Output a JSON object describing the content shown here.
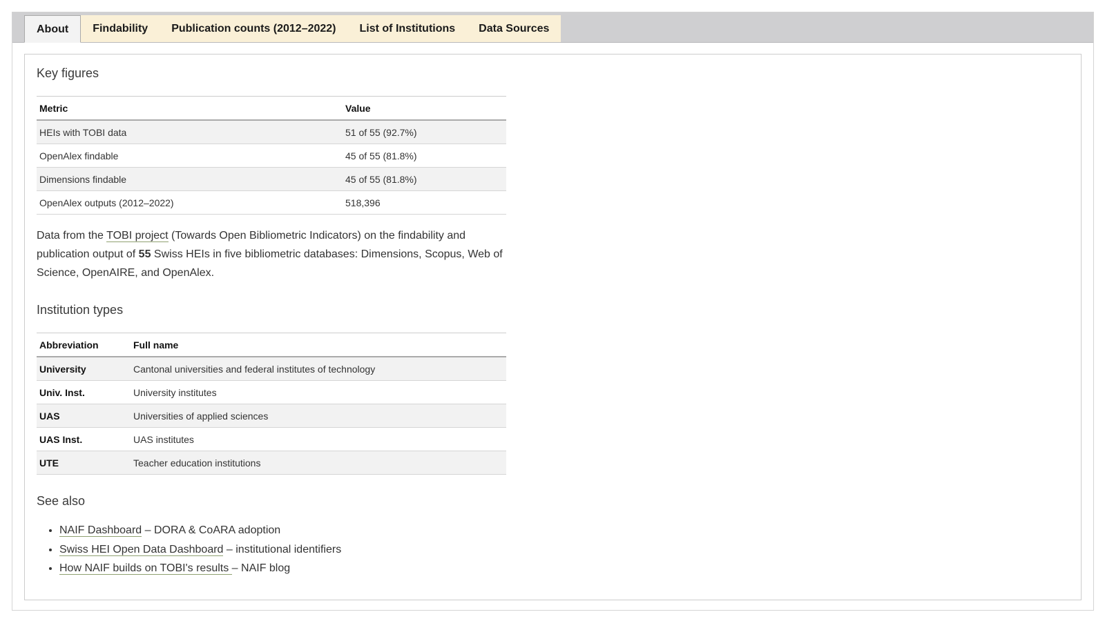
{
  "tabs": [
    {
      "label": "About",
      "active": true
    },
    {
      "label": "Findability",
      "active": false
    },
    {
      "label": "Publication counts (2012–2022)",
      "active": false
    },
    {
      "label": "List of Institutions",
      "active": false
    },
    {
      "label": "Data Sources",
      "active": false
    }
  ],
  "key_figures": {
    "title": "Key figures",
    "headers": [
      "Metric",
      "Value"
    ],
    "rows": [
      [
        "HEIs with TOBI data",
        "51 of 55 (92.7%)"
      ],
      [
        "OpenAlex findable",
        "45 of 55 (81.8%)"
      ],
      [
        "Dimensions findable",
        "45 of 55 (81.8%)"
      ],
      [
        "OpenAlex outputs (2012–2022)",
        "518,396"
      ]
    ]
  },
  "description": {
    "prefix": "Data from the ",
    "link": "TOBI project",
    "middle": " (Towards Open Bibliometric Indicators) on the findability and publication output of ",
    "count": "55",
    "suffix": " Swiss HEIs in five bibliometric databases: Dimensions, Scopus, Web of Science, OpenAIRE, and OpenAlex."
  },
  "institution_types": {
    "title": "Institution types",
    "headers": [
      "Abbreviation",
      "Full name"
    ],
    "rows": [
      [
        "University",
        "Cantonal universities and federal institutes of technology"
      ],
      [
        "Univ. Inst.",
        "University institutes"
      ],
      [
        "UAS",
        "Universities of applied sciences"
      ],
      [
        "UAS Inst.",
        "UAS institutes"
      ],
      [
        "UTE",
        "Teacher education institutions"
      ]
    ]
  },
  "see_also": {
    "title": "See also",
    "items": [
      {
        "link": "NAIF Dashboard",
        "text": " – DORA & CoARA adoption"
      },
      {
        "link": "Swiss HEI Open Data Dashboard",
        "text": " – institutional identifiers"
      },
      {
        "link": "How NAIF builds on TOBI's results ",
        "text": "– NAIF blog"
      }
    ]
  }
}
